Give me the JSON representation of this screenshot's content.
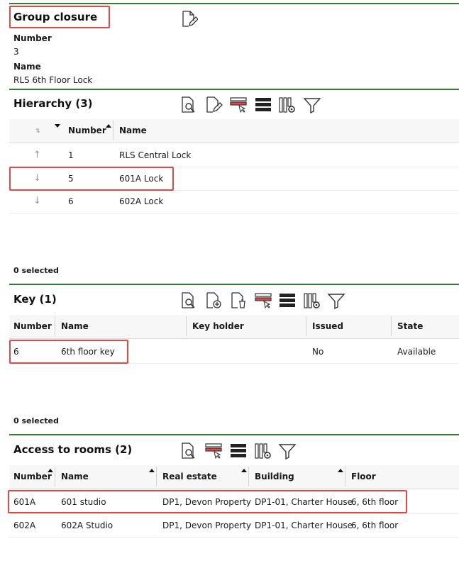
{
  "group": {
    "title": "Group closure",
    "number_label": "Number",
    "number_value": "3",
    "name_label": "Name",
    "name_value": "RLS 6th Floor Lock"
  },
  "hierarchy": {
    "title": "Hierarchy (3)",
    "columns": [
      "Number",
      "Name"
    ],
    "rows": [
      {
        "arrow": "up-arrow-icon",
        "number": "1",
        "name": "RLS Central Lock"
      },
      {
        "arrow": "down-arrow-icon",
        "number": "5",
        "name": "601A Lock"
      },
      {
        "arrow": "down-arrow-icon",
        "number": "6",
        "name": "602A Lock"
      }
    ],
    "selected": "0 selected"
  },
  "key": {
    "title": "Key (1)",
    "columns": [
      "Number",
      "Name",
      "Key holder",
      "Issued",
      "State"
    ],
    "rows": [
      {
        "number": "6",
        "name": "6th floor key",
        "holder": "",
        "issued": "No",
        "state": "Available"
      }
    ],
    "selected": "0 selected"
  },
  "access": {
    "title": "Access to rooms (2)",
    "columns": [
      "Number",
      "Name",
      "Real estate",
      "Building",
      "Floor"
    ],
    "rows": [
      {
        "number": "601A",
        "name": "601 studio",
        "estate": "DP1, Devon Property",
        "building": "DP1-01, Charter House",
        "floor": "6, 6th floor"
      },
      {
        "number": "602A",
        "name": "602A Studio",
        "estate": "DP1, Devon Property",
        "building": "DP1-01, Charter House",
        "floor": "6, 6th floor"
      }
    ]
  },
  "colors": {
    "accent": "#2e7d32",
    "highlight": "#e34848"
  }
}
